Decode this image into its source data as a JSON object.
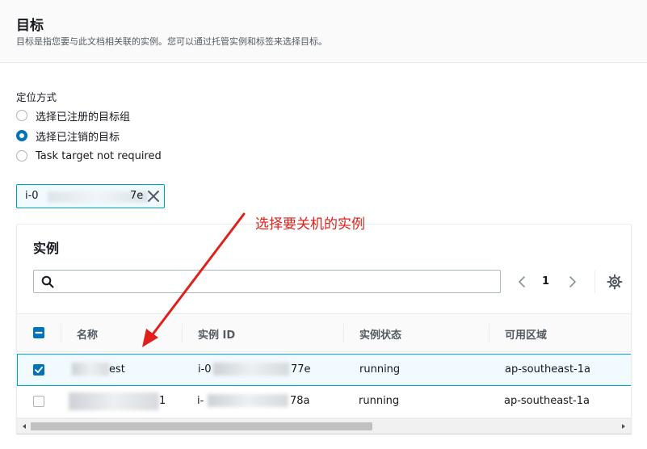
{
  "header": {
    "title": "目标",
    "description": "目标是指您要与此文档相关联的实例。您可以通过托管实例和标签来选择目标。"
  },
  "targeting": {
    "label": "定位方式",
    "options": [
      {
        "label": "选择已注册的目标组",
        "selected": false
      },
      {
        "label": "选择已注销的目标",
        "selected": true
      },
      {
        "label": "Task target not required",
        "selected": false
      }
    ]
  },
  "token": {
    "prefix": "i-0",
    "suffix": "7e"
  },
  "annotation": {
    "text": "选择要关机的实例",
    "color": "#e0201b"
  },
  "instances": {
    "title": "实例",
    "search": {
      "placeholder": "",
      "value": ""
    },
    "pagination": {
      "current_page": "1"
    },
    "columns": [
      "名称",
      "实例 ID",
      "实例状态",
      "可用区域"
    ],
    "rows": [
      {
        "selected": true,
        "name_visible": "est",
        "id_prefix": "i-0",
        "id_suffix": "77e",
        "state": "running",
        "zone": "ap-southeast-1a"
      },
      {
        "selected": false,
        "name_visible": "1",
        "id_prefix": "i-",
        "id_suffix": "78a",
        "state": "running",
        "zone": "ap-southeast-1a"
      }
    ]
  },
  "colors": {
    "accent": "#0073bb",
    "selection_border": "#00a1c9",
    "selection_bg": "#f1faff"
  },
  "icons": {
    "search": "search-icon",
    "settings": "gear-icon",
    "remove": "close-icon",
    "prev": "chevron-left-icon",
    "next": "chevron-right-icon"
  }
}
